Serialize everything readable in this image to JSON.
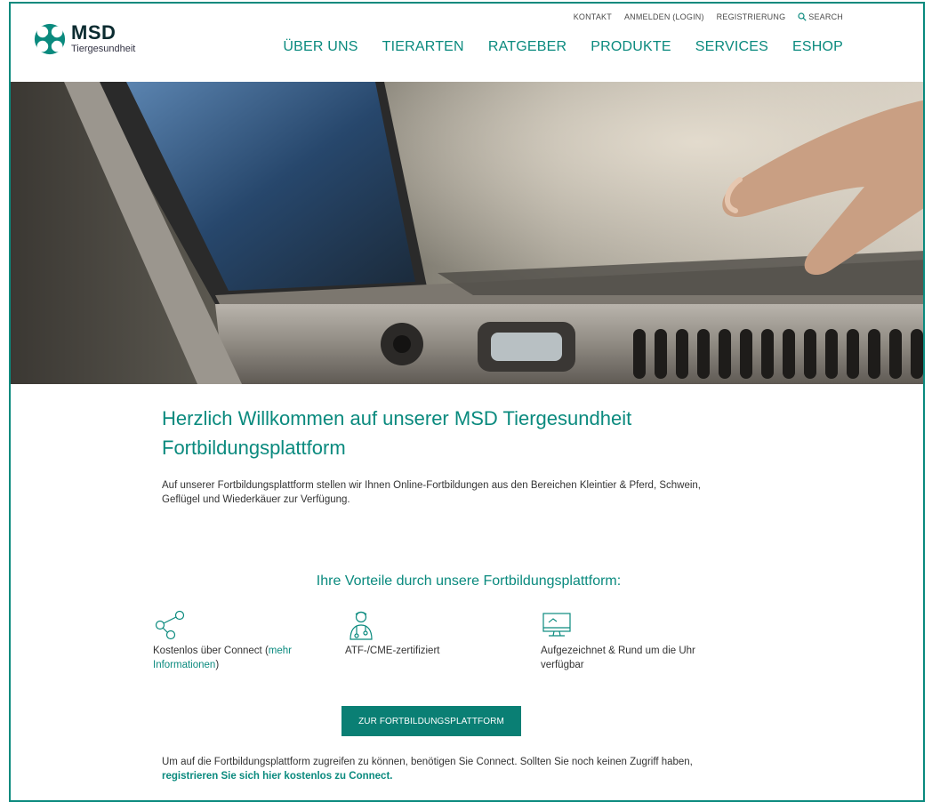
{
  "header": {
    "brand": "MSD",
    "brand_sub": "Tiergesundheit",
    "util_nav": [
      "KONTAKT",
      "ANMELDEN (LOGIN)",
      "REGISTRIERUNG"
    ],
    "search_label": "SEARCH",
    "main_nav": [
      "ÜBER UNS",
      "TIERARTEN",
      "RATGEBER",
      "PRODUKTE",
      "SERVICES",
      "ESHOP"
    ]
  },
  "content": {
    "title": "Herzlich Willkommen auf unserer MSD Tiergesundheit Fortbildungsplattform",
    "intro": "Auf unserer Fortbildungsplattform stellen wir Ihnen Online-Fortbildungen aus den Bereichen Kleintier & Pferd, Schwein, Geflügel und Wiederkäuer zur Verfügung.",
    "benefits_title": "Ihre Vorteile durch unsere Fortbildungsplattform:",
    "benefits": [
      {
        "text": "Kostenlos über Connect (",
        "link": "mehr Informationen",
        "after": ")",
        "icon": "share-icon"
      },
      {
        "text": "ATF-/CME-zertifiziert",
        "icon": "doctor-icon"
      },
      {
        "text": "Aufgezeichnet & Rund um die Uhr verfügbar",
        "icon": "monitor-icon"
      }
    ],
    "cta_label": "ZUR FORTBILDUNGSPLATTFORM",
    "note_text": "Um auf die Fortbildungsplattform zugreifen zu können, benötigen Sie Connect. Sollten Sie noch keinen Zugriff haben, ",
    "note_link": "registrieren Sie sich hier kostenlos zu Connect."
  },
  "colors": {
    "accent": "#0a8a7e",
    "button": "#0a7f74",
    "frame": "#0a8a7e"
  }
}
